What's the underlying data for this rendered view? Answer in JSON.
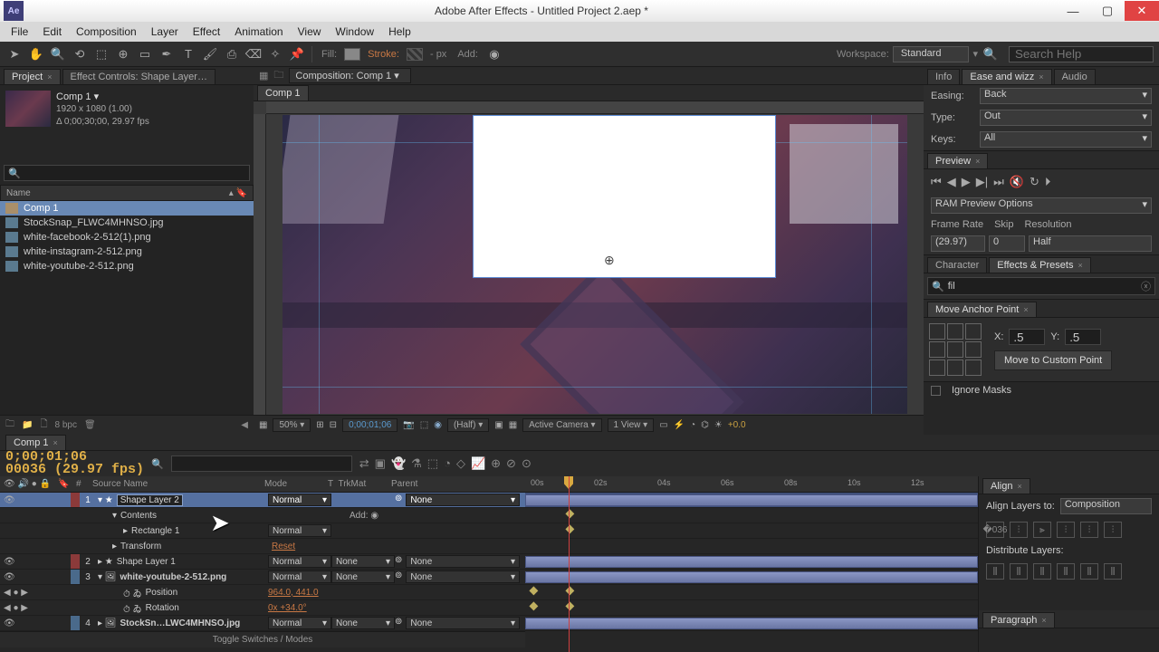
{
  "window": {
    "title": "Adobe After Effects - Untitled Project 2.aep *",
    "logo_text": "Ae"
  },
  "menu": [
    "File",
    "Edit",
    "Composition",
    "Layer",
    "Effect",
    "Animation",
    "View",
    "Window",
    "Help"
  ],
  "toolbar": {
    "fill_label": "Fill:",
    "stroke_label": "Stroke:",
    "stroke_px": "- px",
    "add_label": "Add:",
    "workspace_label": "Workspace:",
    "workspace_value": "Standard",
    "search_placeholder": "Search Help"
  },
  "project": {
    "tab_project": "Project",
    "tab_effect_controls": "Effect Controls: Shape Layer…",
    "comp_name": "Comp 1 ▾",
    "comp_size": "1920 x 1080 (1.00)",
    "comp_duration": "Δ 0;00;30;00, 29.97 fps",
    "name_col": "Name",
    "items": [
      {
        "name": "Comp 1",
        "type": "comp",
        "selected": true
      },
      {
        "name": "StockSnap_FLWC4MHNSO.jpg",
        "type": "img"
      },
      {
        "name": "white-facebook-2-512(1).png",
        "type": "img"
      },
      {
        "name": "white-instagram-2-512.png",
        "type": "img"
      },
      {
        "name": "white-youtube-2-512.png",
        "type": "img"
      }
    ],
    "bpc": "8 bpc"
  },
  "comp_viewer": {
    "dropdown": "Composition: Comp 1",
    "inner_tab": "Comp 1",
    "zoom": "50%",
    "time": "0;00;01;06",
    "res": "(Half)",
    "camera": "Active Camera",
    "view": "1 View",
    "exposure": "+0.0"
  },
  "right": {
    "info_tab": "Info",
    "ease_tab": "Ease and wizz",
    "audio_tab": "Audio",
    "easing_lbl": "Easing:",
    "easing_val": "Back",
    "type_lbl": "Type:",
    "type_val": "Out",
    "keys_lbl": "Keys:",
    "keys_val": "All",
    "preview_tab": "Preview",
    "ram_options": "RAM Preview Options",
    "framerate_lbl": "Frame Rate",
    "framerate_val": "(29.97)",
    "skip_lbl": "Skip",
    "skip_val": "0",
    "resolution_lbl": "Resolution",
    "resolution_val": "Half",
    "character_tab": "Character",
    "effects_tab": "Effects & Presets",
    "effects_search": "fil",
    "map_tab": "Move Anchor Point",
    "x_lbl": "X:",
    "x_val": ".5",
    "y_lbl": "Y:",
    "y_val": ".5",
    "map_btn": "Move to Custom Point",
    "ignore_masks": "Ignore Masks",
    "align_tab": "Align",
    "align_to_lbl": "Align Layers to:",
    "align_to_val": "Composition",
    "distribute_lbl": "Distribute Layers:",
    "paragraph_tab": "Paragraph"
  },
  "timeline": {
    "tab": "Comp 1",
    "timecode": "0;00;01;06",
    "timecode_sub": "00036 (29.97 fps)",
    "cols": {
      "num": "#",
      "source": "Source Name",
      "mode": "Mode",
      "trkmat": "TrkMat",
      "parent": "Parent"
    },
    "layers": [
      {
        "num": "1",
        "name": "Shape Layer 2",
        "mode": "Normal",
        "parent": "None",
        "selected": true,
        "star": true,
        "renaming": true
      },
      {
        "num": "2",
        "name": "Shape Layer 1",
        "mode": "Normal",
        "trkmat": "None",
        "parent": "None",
        "star": true
      },
      {
        "num": "3",
        "name": "white-youtube-2-512.png",
        "mode": "Normal",
        "trkmat": "None",
        "parent": "None"
      },
      {
        "num": "4",
        "name": "StockSn…LWC4MHNSO.jpg",
        "mode": "Normal",
        "trkmat": "None",
        "parent": "None"
      }
    ],
    "sub": {
      "contents": "Contents",
      "add": "Add:",
      "rect": "Rectangle 1",
      "rect_mode": "Normal",
      "transform": "Transform",
      "reset": "Reset",
      "position": "Position",
      "position_val": "964.0, 441.0",
      "rotation": "Rotation",
      "rotation_val": "0x +34.0°"
    },
    "ticks": [
      "00s",
      "02s",
      "04s",
      "06s",
      "08s",
      "10s",
      "12s"
    ],
    "toggle": "Toggle Switches / Modes"
  }
}
